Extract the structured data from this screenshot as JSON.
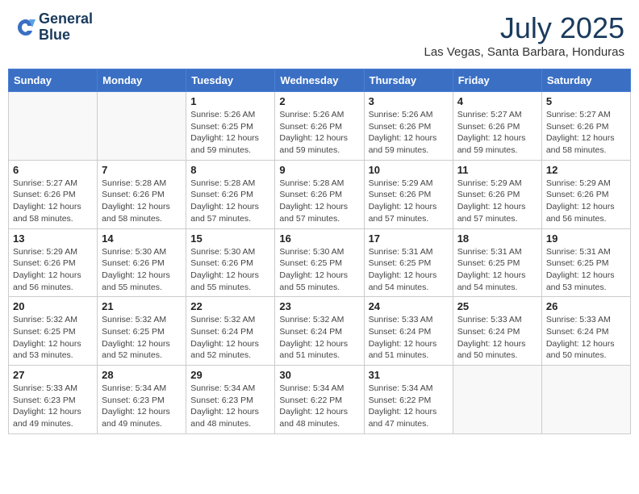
{
  "header": {
    "logo_line1": "General",
    "logo_line2": "Blue",
    "month_year": "July 2025",
    "location": "Las Vegas, Santa Barbara, Honduras"
  },
  "days_of_week": [
    "Sunday",
    "Monday",
    "Tuesday",
    "Wednesday",
    "Thursday",
    "Friday",
    "Saturday"
  ],
  "weeks": [
    [
      {
        "day": "",
        "info": ""
      },
      {
        "day": "",
        "info": ""
      },
      {
        "day": "1",
        "info": "Sunrise: 5:26 AM\nSunset: 6:25 PM\nDaylight: 12 hours and 59 minutes."
      },
      {
        "day": "2",
        "info": "Sunrise: 5:26 AM\nSunset: 6:26 PM\nDaylight: 12 hours and 59 minutes."
      },
      {
        "day": "3",
        "info": "Sunrise: 5:26 AM\nSunset: 6:26 PM\nDaylight: 12 hours and 59 minutes."
      },
      {
        "day": "4",
        "info": "Sunrise: 5:27 AM\nSunset: 6:26 PM\nDaylight: 12 hours and 59 minutes."
      },
      {
        "day": "5",
        "info": "Sunrise: 5:27 AM\nSunset: 6:26 PM\nDaylight: 12 hours and 58 minutes."
      }
    ],
    [
      {
        "day": "6",
        "info": "Sunrise: 5:27 AM\nSunset: 6:26 PM\nDaylight: 12 hours and 58 minutes."
      },
      {
        "day": "7",
        "info": "Sunrise: 5:28 AM\nSunset: 6:26 PM\nDaylight: 12 hours and 58 minutes."
      },
      {
        "day": "8",
        "info": "Sunrise: 5:28 AM\nSunset: 6:26 PM\nDaylight: 12 hours and 57 minutes."
      },
      {
        "day": "9",
        "info": "Sunrise: 5:28 AM\nSunset: 6:26 PM\nDaylight: 12 hours and 57 minutes."
      },
      {
        "day": "10",
        "info": "Sunrise: 5:29 AM\nSunset: 6:26 PM\nDaylight: 12 hours and 57 minutes."
      },
      {
        "day": "11",
        "info": "Sunrise: 5:29 AM\nSunset: 6:26 PM\nDaylight: 12 hours and 57 minutes."
      },
      {
        "day": "12",
        "info": "Sunrise: 5:29 AM\nSunset: 6:26 PM\nDaylight: 12 hours and 56 minutes."
      }
    ],
    [
      {
        "day": "13",
        "info": "Sunrise: 5:29 AM\nSunset: 6:26 PM\nDaylight: 12 hours and 56 minutes."
      },
      {
        "day": "14",
        "info": "Sunrise: 5:30 AM\nSunset: 6:26 PM\nDaylight: 12 hours and 55 minutes."
      },
      {
        "day": "15",
        "info": "Sunrise: 5:30 AM\nSunset: 6:26 PM\nDaylight: 12 hours and 55 minutes."
      },
      {
        "day": "16",
        "info": "Sunrise: 5:30 AM\nSunset: 6:25 PM\nDaylight: 12 hours and 55 minutes."
      },
      {
        "day": "17",
        "info": "Sunrise: 5:31 AM\nSunset: 6:25 PM\nDaylight: 12 hours and 54 minutes."
      },
      {
        "day": "18",
        "info": "Sunrise: 5:31 AM\nSunset: 6:25 PM\nDaylight: 12 hours and 54 minutes."
      },
      {
        "day": "19",
        "info": "Sunrise: 5:31 AM\nSunset: 6:25 PM\nDaylight: 12 hours and 53 minutes."
      }
    ],
    [
      {
        "day": "20",
        "info": "Sunrise: 5:32 AM\nSunset: 6:25 PM\nDaylight: 12 hours and 53 minutes."
      },
      {
        "day": "21",
        "info": "Sunrise: 5:32 AM\nSunset: 6:25 PM\nDaylight: 12 hours and 52 minutes."
      },
      {
        "day": "22",
        "info": "Sunrise: 5:32 AM\nSunset: 6:24 PM\nDaylight: 12 hours and 52 minutes."
      },
      {
        "day": "23",
        "info": "Sunrise: 5:32 AM\nSunset: 6:24 PM\nDaylight: 12 hours and 51 minutes."
      },
      {
        "day": "24",
        "info": "Sunrise: 5:33 AM\nSunset: 6:24 PM\nDaylight: 12 hours and 51 minutes."
      },
      {
        "day": "25",
        "info": "Sunrise: 5:33 AM\nSunset: 6:24 PM\nDaylight: 12 hours and 50 minutes."
      },
      {
        "day": "26",
        "info": "Sunrise: 5:33 AM\nSunset: 6:24 PM\nDaylight: 12 hours and 50 minutes."
      }
    ],
    [
      {
        "day": "27",
        "info": "Sunrise: 5:33 AM\nSunset: 6:23 PM\nDaylight: 12 hours and 49 minutes."
      },
      {
        "day": "28",
        "info": "Sunrise: 5:34 AM\nSunset: 6:23 PM\nDaylight: 12 hours and 49 minutes."
      },
      {
        "day": "29",
        "info": "Sunrise: 5:34 AM\nSunset: 6:23 PM\nDaylight: 12 hours and 48 minutes."
      },
      {
        "day": "30",
        "info": "Sunrise: 5:34 AM\nSunset: 6:22 PM\nDaylight: 12 hours and 48 minutes."
      },
      {
        "day": "31",
        "info": "Sunrise: 5:34 AM\nSunset: 6:22 PM\nDaylight: 12 hours and 47 minutes."
      },
      {
        "day": "",
        "info": ""
      },
      {
        "day": "",
        "info": ""
      }
    ]
  ]
}
